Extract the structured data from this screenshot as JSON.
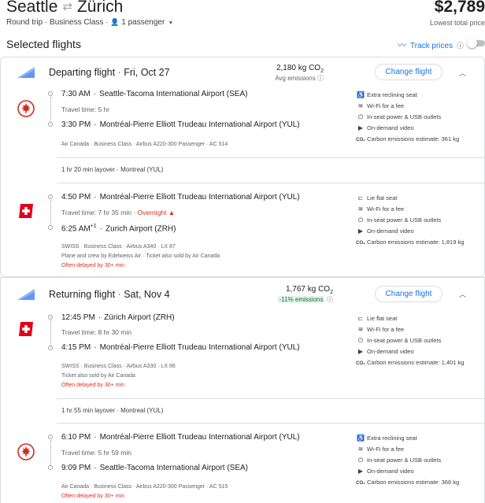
{
  "header": {
    "origin": "Seattle",
    "swap_icon": "swap-arrows-icon",
    "destination": "Zürich",
    "trip_type": "Round trip",
    "cabin": "Business Class",
    "passengers": "1 passenger",
    "price": "$2,789",
    "price_label": "Lowest total price"
  },
  "selected_title": "Selected flights",
  "track_prices": "Track prices",
  "depart": {
    "title": "Departing flight",
    "date": "Fri, Oct 27",
    "co2": "2,180 kg CO",
    "co2_sub": "2",
    "emissions_note": "Avg emissions",
    "change_label": "Change flight",
    "seg1": {
      "dep_time": "7:30 AM",
      "dep_airport": "Seattle-Tacoma International Airport (SEA)",
      "travel": "Travel time: 5 hr",
      "arr_time": "3:30 PM",
      "arr_airport": "Montréal-Pierre Elliott Trudeau International Airport (YUL)",
      "meta": "Air Canada · Business Class · Airbus A220-300 Passenger · AC 514",
      "amenities": [
        "Extra reclining seat",
        "Wi-Fi for a fee",
        "In-seat power & USB outlets",
        "On-demand video",
        "Carbon emissions estimate: 361 kg"
      ]
    },
    "layover": "1 hr 20 min layover · Montreal (YUL)",
    "seg2": {
      "dep_time": "4:50 PM",
      "dep_airport": "Montréal-Pierre Elliott Trudeau International Airport (YUL)",
      "travel": "Travel time: 7 hr 35 min",
      "overnight": "Overnight",
      "arr_time": "6:25 AM",
      "arr_plus": "+1",
      "arr_airport": "Zurich Airport (ZRH)",
      "meta1": "SWISS · Business Class · Airbus A340 · LX 87",
      "meta2": "Plane and crew by Edelweiss Air · Ticket also sold by Air Canada",
      "delay": "Often delayed by 30+ min",
      "amenities": [
        "Lie flat seat",
        "Wi-Fi for a fee",
        "In-seat power & USB outlets",
        "On-demand video",
        "Carbon emissions estimate: 1,819 kg"
      ]
    }
  },
  "return": {
    "title": "Returning flight",
    "date": "Sat, Nov 4",
    "co2": "1,767 kg CO",
    "co2_sub": "2",
    "emissions_note": "-11% emissions",
    "change_label": "Change flight",
    "seg1": {
      "dep_time": "12:45 PM",
      "dep_airport": "Zürich Airport (ZRH)",
      "travel": "Travel time: 8 hr 30 min",
      "arr_time": "4:15 PM",
      "arr_airport": "Montréal-Pierre Elliott Trudeau International Airport (YUL)",
      "meta1": "SWISS · Business Class · Airbus A330 · LX 86",
      "meta2": "Ticket also sold by Air Canada",
      "delay": "Often delayed by 30+ min",
      "amenities": [
        "Lie flat seat",
        "Wi-Fi for a fee",
        "In-seat power & USB outlets",
        "On-demand video",
        "Carbon emissions estimate: 1,401 kg"
      ]
    },
    "layover": "1 hr 55 min layover · Montreal (YUL)",
    "seg2": {
      "dep_time": "6:10 PM",
      "dep_airport": "Montréal-Pierre Elliott Trudeau International Airport (YUL)",
      "travel": "Travel time: 5 hr 59 min",
      "arr_time": "9:09 PM",
      "arr_airport": "Seattle-Tacoma International Airport (SEA)",
      "meta": "Air Canada · Business Class · Airbus A220-300 Passenger · AC 515",
      "delay": "Often delayed by 30+ min",
      "amenities": [
        "Extra reclining seat",
        "Wi-Fi for a fee",
        "In-seat power & USB outlets",
        "On-demand video",
        "Carbon emissions estimate: 366 kg"
      ]
    }
  },
  "colors": {
    "accent": "#1a73e8",
    "air_canada_red": "#d52b1e",
    "swiss_red": "#e2001a",
    "warning": "#d93025",
    "green": "#137333"
  }
}
